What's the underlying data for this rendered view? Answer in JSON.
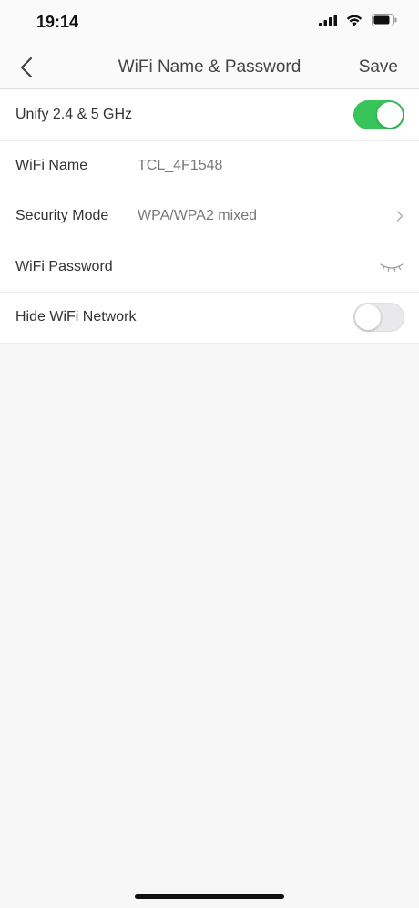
{
  "status_bar": {
    "time": "19:14"
  },
  "nav": {
    "title": "WiFi Name & Password",
    "save_label": "Save"
  },
  "rows": {
    "unify": {
      "label": "Unify 2.4 & 5 GHz",
      "enabled": true
    },
    "wifi_name": {
      "label": "WiFi Name",
      "value": "TCL_4F1548"
    },
    "security_mode": {
      "label": "Security Mode",
      "value": "WPA/WPA2 mixed"
    },
    "wifi_password": {
      "label": "WiFi Password"
    },
    "hide_network": {
      "label": "Hide WiFi Network",
      "enabled": false
    }
  },
  "colors": {
    "toggle_on": "#37c45b",
    "toggle_off": "#e9e9eb",
    "background": "#f7f7f7"
  },
  "icons": [
    "back-chevron-icon",
    "signal-icon",
    "wifi-icon",
    "battery-icon",
    "chevron-right-icon",
    "eye-closed-icon"
  ]
}
